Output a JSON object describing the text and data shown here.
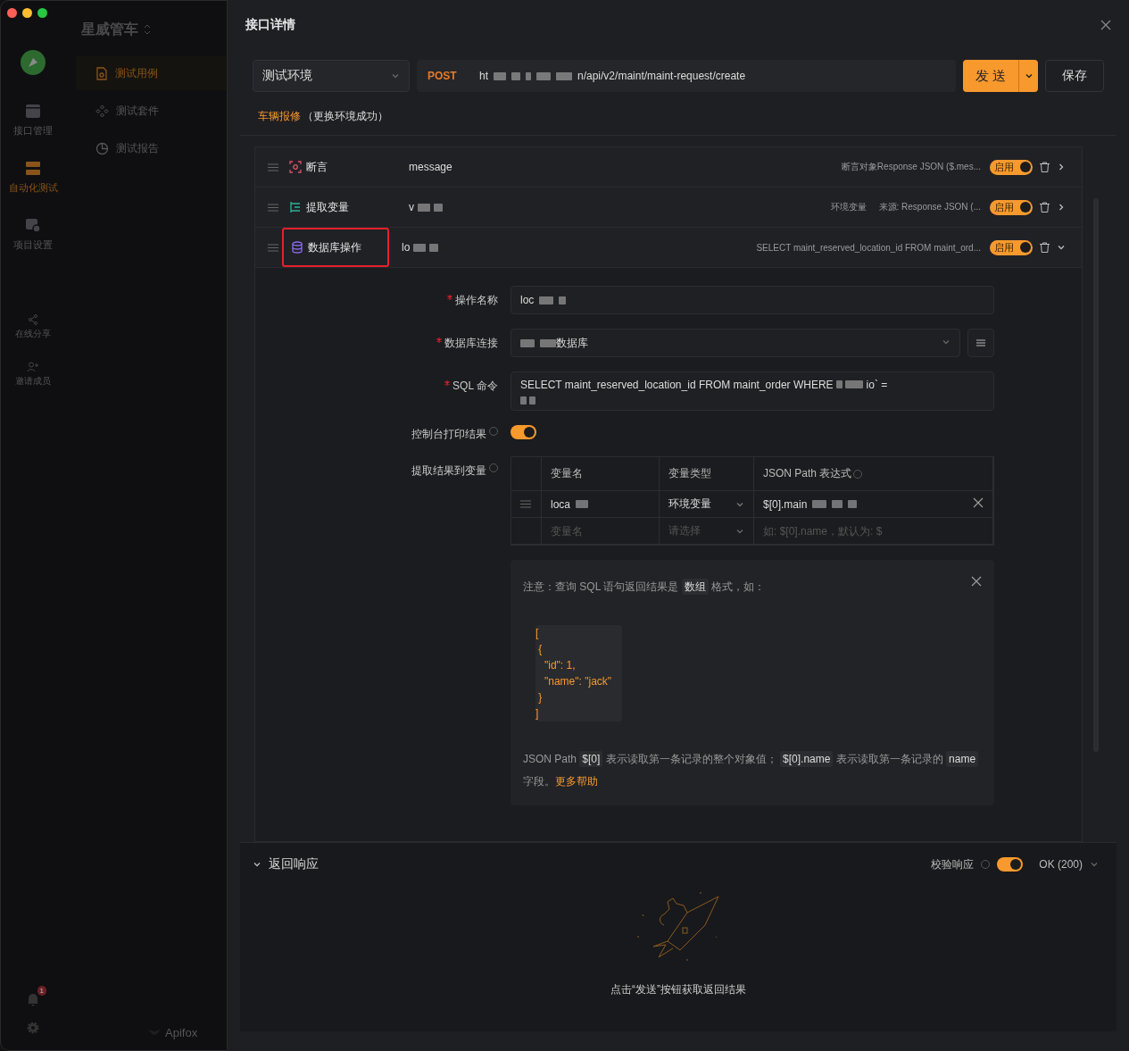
{
  "sidebar": {
    "project": "星威管车",
    "nav": [
      {
        "kind": "api",
        "label": "接口管理",
        "selected": false
      },
      {
        "kind": "auto",
        "label": "自动化测试",
        "selected": true
      },
      {
        "kind": "settings",
        "label": "项目设置",
        "selected": false
      }
    ],
    "secondary_nav": [
      {
        "kind": "share",
        "label": "在线分享"
      },
      {
        "kind": "invite",
        "label": "邀请成员"
      }
    ],
    "menu": [
      {
        "kind": "case",
        "label": "测试用例",
        "selected": true
      },
      {
        "kind": "suite",
        "label": "测试套件",
        "selected": false
      },
      {
        "kind": "report",
        "label": "测试报告",
        "selected": false
      }
    ],
    "notification_count": "1",
    "brand": "Apifox"
  },
  "drawer": {
    "title": "接口详情",
    "environment": "测试环境",
    "method": "POST",
    "url_start": "ht",
    "url_end": "n/api/v2/maint/maint-request/create",
    "send": "发 送",
    "save": "保存",
    "breadcrumb": {
      "name": "车辆报修",
      "status": "（更换环境成功）"
    }
  },
  "processors": [
    {
      "kind": "assert",
      "name": "断言",
      "value": "message",
      "summary": [
        "断言对象Response JSON ($.mes..."
      ],
      "toggle_label": "启用",
      "on": true,
      "expanded": false,
      "highlighted": false
    },
    {
      "kind": "extract",
      "name": "提取变量",
      "value": "v",
      "summary": [
        "环境变量",
        "来源: Response JSON (..."
      ],
      "toggle_label": "启用",
      "on": true,
      "expanded": false,
      "highlighted": false
    },
    {
      "kind": "database",
      "name": "数据库操作",
      "value": "lo",
      "summary": [
        "SELECT maint_reserved_location_id FROM maint_ord..."
      ],
      "toggle_label": "启用",
      "on": true,
      "expanded": true,
      "highlighted": true
    }
  ],
  "db_form": {
    "fields": [
      {
        "kind": "input",
        "label": "操作名称",
        "required": true,
        "value": "loc"
      },
      {
        "kind": "select",
        "label": "数据库连接",
        "required": true,
        "value": "数据库"
      },
      {
        "kind": "textarea",
        "label": "SQL 命令",
        "required": true,
        "value": "SELECT maint_reserved_location_id FROM maint_order WHERE",
        "value_end": "io` ="
      }
    ],
    "print_label": "控制台打印结果",
    "print_on": true,
    "extract_label": "提取结果到变量",
    "table": {
      "columns": [
        "变量名",
        "变量类型",
        "JSON Path 表达式"
      ],
      "rows": [
        {
          "name": "loca",
          "type": "环境变量",
          "path": "$[0].main"
        }
      ],
      "new_row": {
        "name_placeholder": "变量名",
        "type_placeholder": "请选择",
        "path_placeholder": "如: $[0].name，默认为: $"
      }
    },
    "note": {
      "intro": [
        {
          "kind": "text",
          "text": "注意：查询 SQL 语句返回结果是 "
        },
        {
          "kind": "code",
          "text": "数组"
        },
        {
          "kind": "text",
          "text": " 格式，如："
        }
      ],
      "code": "[\n {\n   \"id\": 1,\n   \"name\": \"jack\"\n }\n]",
      "explain": [
        {
          "kind": "text",
          "text": "JSON Path "
        },
        {
          "kind": "code",
          "text": "$[0]"
        },
        {
          "kind": "text",
          "text": " 表示读取第一条记录的整个对象值； "
        },
        {
          "kind": "code",
          "text": "$[0].name"
        },
        {
          "kind": "text",
          "text": " 表示读取第一条记录的 "
        },
        {
          "kind": "code",
          "text": "name"
        },
        {
          "kind": "text",
          "text": " 字段。"
        },
        {
          "kind": "link",
          "text": "更多帮助"
        }
      ]
    }
  },
  "response": {
    "title": "返回响应",
    "expanded": true,
    "validate_label": "校验响应",
    "validate_on": true,
    "status": "OK (200)",
    "empty_text": "点击“发送”按钮获取返回结果"
  }
}
